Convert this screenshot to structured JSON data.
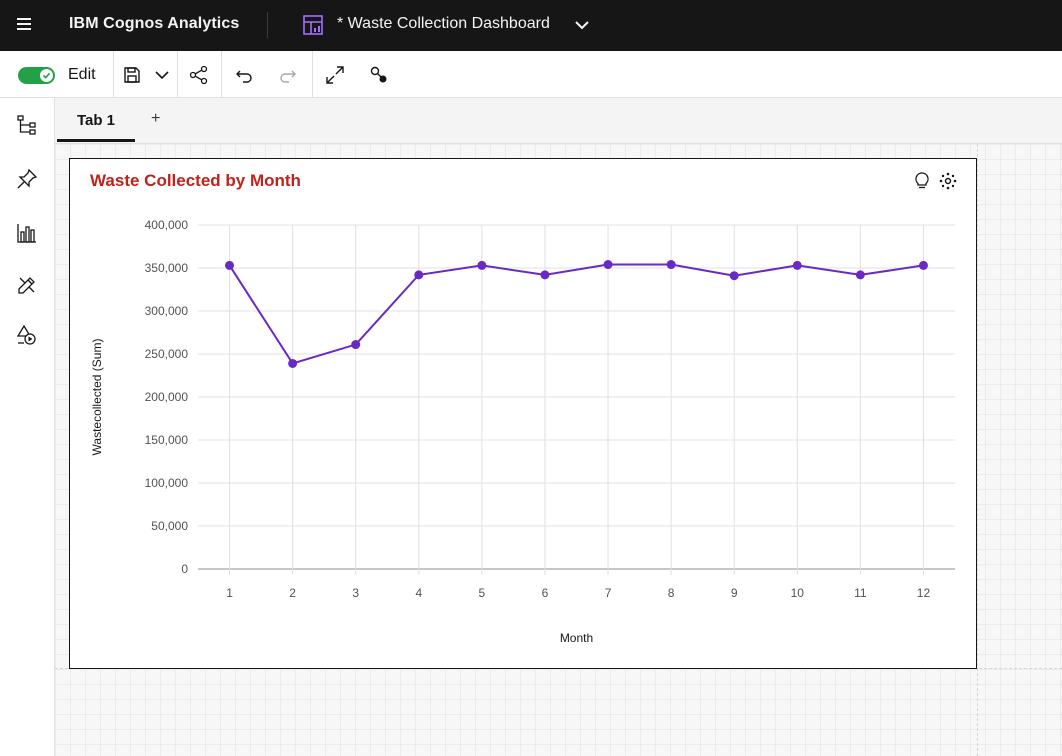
{
  "header": {
    "brand": "IBM Cognos Analytics",
    "dashboard_title": "* Waste Collection Dashboard"
  },
  "toolbar": {
    "edit_label": "Edit",
    "edit_enabled": true,
    "toggle_color": "#24a148"
  },
  "tabs": [
    {
      "label": "Tab 1",
      "active": true
    }
  ],
  "tab_add_label": "+",
  "widget": {
    "title": "Waste Collected by Month",
    "title_color": "#c0231b"
  },
  "chart_data": {
    "type": "line",
    "title": "Waste Collected by Month",
    "xlabel": "Month",
    "ylabel": "Wastecollected (Sum)",
    "categories": [
      "1",
      "2",
      "3",
      "4",
      "5",
      "6",
      "7",
      "8",
      "9",
      "10",
      "11",
      "12"
    ],
    "series": [
      {
        "values": [
          353000,
          239000,
          261000,
          342000,
          353000,
          342000,
          354000,
          354000,
          341000,
          353000,
          342000,
          353000
        ],
        "color": "#6929c4"
      }
    ],
    "ylim": [
      0,
      400000
    ],
    "yticks": [
      "0",
      "50,000",
      "100,000",
      "150,000",
      "200,000",
      "250,000",
      "300,000",
      "350,000",
      "400,000"
    ],
    "grid": true
  }
}
